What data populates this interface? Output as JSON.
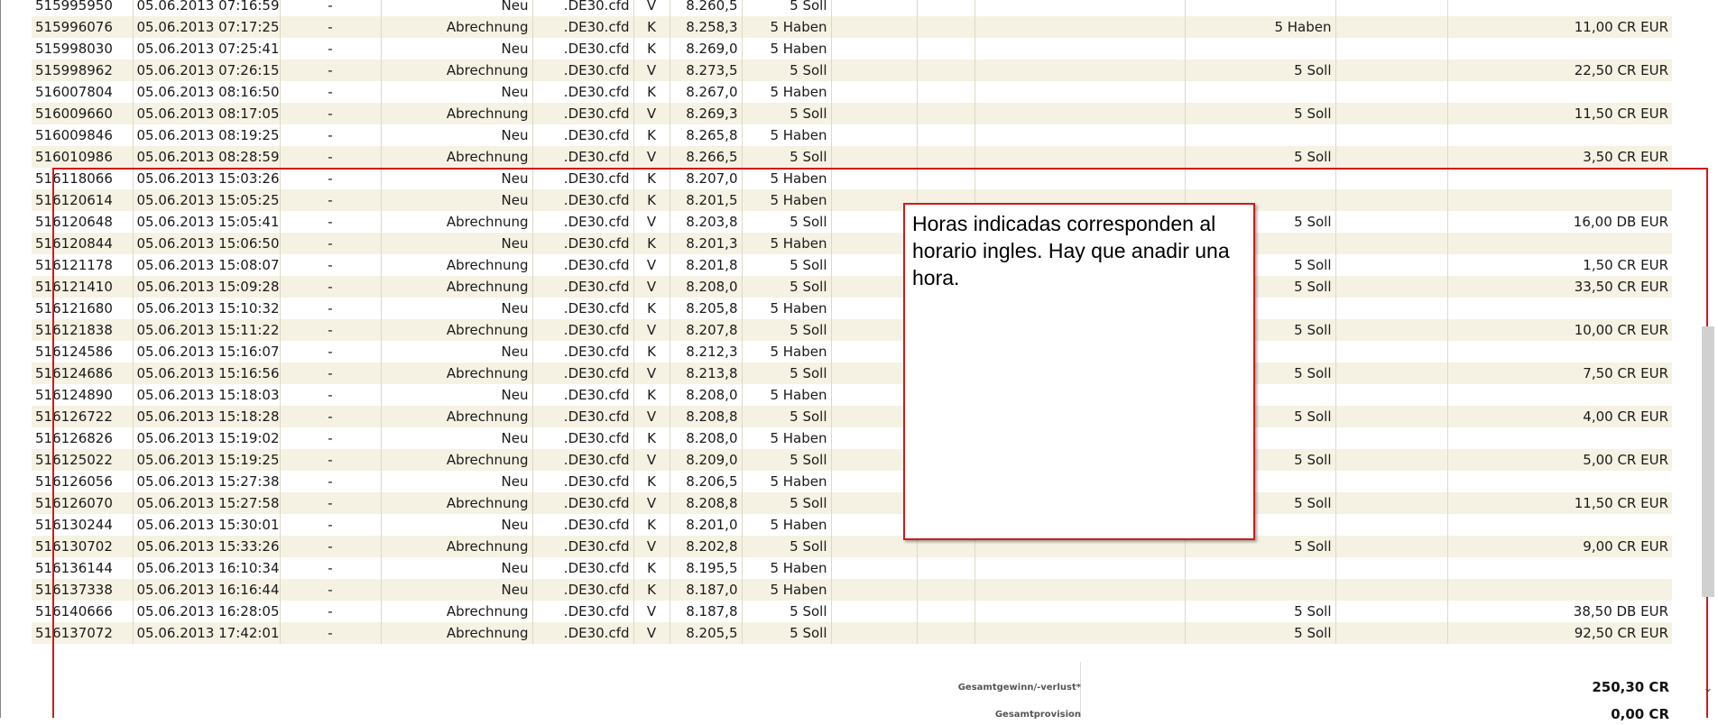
{
  "transactions": [
    {
      "id": "515995950",
      "datetime": "05.06.2013 07:16:59",
      "dash": "-",
      "type": "Neu",
      "instrument": ".DE30.cfd",
      "side": "V",
      "price": "8.260,5",
      "qty": "5 Soll",
      "status": "",
      "amount": ""
    },
    {
      "id": "515996076",
      "datetime": "05.06.2013 07:17:25",
      "dash": "-",
      "type": "Abrechnung",
      "instrument": ".DE30.cfd",
      "side": "K",
      "price": "8.258,3",
      "qty": "5 Haben",
      "status": "5 Haben",
      "amount": "11,00 CR EUR"
    },
    {
      "id": "515998030",
      "datetime": "05.06.2013 07:25:41",
      "dash": "-",
      "type": "Neu",
      "instrument": ".DE30.cfd",
      "side": "K",
      "price": "8.269,0",
      "qty": "5 Haben",
      "status": "",
      "amount": ""
    },
    {
      "id": "515998962",
      "datetime": "05.06.2013 07:26:15",
      "dash": "-",
      "type": "Abrechnung",
      "instrument": ".DE30.cfd",
      "side": "V",
      "price": "8.273,5",
      "qty": "5 Soll",
      "status": "5 Soll",
      "amount": "22,50 CR EUR"
    },
    {
      "id": "516007804",
      "datetime": "05.06.2013 08:16:50",
      "dash": "-",
      "type": "Neu",
      "instrument": ".DE30.cfd",
      "side": "K",
      "price": "8.267,0",
      "qty": "5 Haben",
      "status": "",
      "amount": ""
    },
    {
      "id": "516009660",
      "datetime": "05.06.2013 08:17:05",
      "dash": "-",
      "type": "Abrechnung",
      "instrument": ".DE30.cfd",
      "side": "V",
      "price": "8.269,3",
      "qty": "5 Soll",
      "status": "5 Soll",
      "amount": "11,50 CR EUR"
    },
    {
      "id": "516009846",
      "datetime": "05.06.2013 08:19:25",
      "dash": "-",
      "type": "Neu",
      "instrument": ".DE30.cfd",
      "side": "K",
      "price": "8.265,8",
      "qty": "5 Haben",
      "status": "",
      "amount": ""
    },
    {
      "id": "516010986",
      "datetime": "05.06.2013 08:28:59",
      "dash": "-",
      "type": "Abrechnung",
      "instrument": ".DE30.cfd",
      "side": "V",
      "price": "8.266,5",
      "qty": "5 Soll",
      "status": "5 Soll",
      "amount": "3,50 CR EUR"
    },
    {
      "id": "516118066",
      "datetime": "05.06.2013 15:03:26",
      "dash": "-",
      "type": "Neu",
      "instrument": ".DE30.cfd",
      "side": "K",
      "price": "8.207,0",
      "qty": "5 Haben",
      "status": "",
      "amount": ""
    },
    {
      "id": "516120614",
      "datetime": "05.06.2013 15:05:25",
      "dash": "-",
      "type": "Neu",
      "instrument": ".DE30.cfd",
      "side": "K",
      "price": "8.201,5",
      "qty": "5 Haben",
      "status": "",
      "amount": ""
    },
    {
      "id": "516120648",
      "datetime": "05.06.2013 15:05:41",
      "dash": "-",
      "type": "Abrechnung",
      "instrument": ".DE30.cfd",
      "side": "V",
      "price": "8.203,8",
      "qty": "5 Soll",
      "status": "5 Soll",
      "amount": "16,00 DB EUR"
    },
    {
      "id": "516120844",
      "datetime": "05.06.2013 15:06:50",
      "dash": "-",
      "type": "Neu",
      "instrument": ".DE30.cfd",
      "side": "K",
      "price": "8.201,3",
      "qty": "5 Haben",
      "status": "",
      "amount": ""
    },
    {
      "id": "516121178",
      "datetime": "05.06.2013 15:08:07",
      "dash": "-",
      "type": "Abrechnung",
      "instrument": ".DE30.cfd",
      "side": "V",
      "price": "8.201,8",
      "qty": "5 Soll",
      "status": "5 Soll",
      "amount": "1,50 CR EUR"
    },
    {
      "id": "516121410",
      "datetime": "05.06.2013 15:09:28",
      "dash": "-",
      "type": "Abrechnung",
      "instrument": ".DE30.cfd",
      "side": "V",
      "price": "8.208,0",
      "qty": "5 Soll",
      "status": "5 Soll",
      "amount": "33,50 CR EUR"
    },
    {
      "id": "516121680",
      "datetime": "05.06.2013 15:10:32",
      "dash": "-",
      "type": "Neu",
      "instrument": ".DE30.cfd",
      "side": "K",
      "price": "8.205,8",
      "qty": "5 Haben",
      "status": "",
      "amount": ""
    },
    {
      "id": "516121838",
      "datetime": "05.06.2013 15:11:22",
      "dash": "-",
      "type": "Abrechnung",
      "instrument": ".DE30.cfd",
      "side": "V",
      "price": "8.207,8",
      "qty": "5 Soll",
      "status": "5 Soll",
      "amount": "10,00 CR EUR"
    },
    {
      "id": "516124586",
      "datetime": "05.06.2013 15:16:07",
      "dash": "-",
      "type": "Neu",
      "instrument": ".DE30.cfd",
      "side": "K",
      "price": "8.212,3",
      "qty": "5 Haben",
      "status": "",
      "amount": ""
    },
    {
      "id": "516124686",
      "datetime": "05.06.2013 15:16:56",
      "dash": "-",
      "type": "Abrechnung",
      "instrument": ".DE30.cfd",
      "side": "V",
      "price": "8.213,8",
      "qty": "5 Soll",
      "status": "5 Soll",
      "amount": "7,50 CR EUR"
    },
    {
      "id": "516124890",
      "datetime": "05.06.2013 15:18:03",
      "dash": "-",
      "type": "Neu",
      "instrument": ".DE30.cfd",
      "side": "K",
      "price": "8.208,0",
      "qty": "5 Haben",
      "status": "",
      "amount": ""
    },
    {
      "id": "516126722",
      "datetime": "05.06.2013 15:18:28",
      "dash": "-",
      "type": "Abrechnung",
      "instrument": ".DE30.cfd",
      "side": "V",
      "price": "8.208,8",
      "qty": "5 Soll",
      "status": "5 Soll",
      "amount": "4,00 CR EUR"
    },
    {
      "id": "516126826",
      "datetime": "05.06.2013 15:19:02",
      "dash": "-",
      "type": "Neu",
      "instrument": ".DE30.cfd",
      "side": "K",
      "price": "8.208,0",
      "qty": "5 Haben",
      "status": "",
      "amount": ""
    },
    {
      "id": "516125022",
      "datetime": "05.06.2013 15:19:25",
      "dash": "-",
      "type": "Abrechnung",
      "instrument": ".DE30.cfd",
      "side": "V",
      "price": "8.209,0",
      "qty": "5 Soll",
      "status": "5 Soll",
      "amount": "5,00 CR EUR"
    },
    {
      "id": "516126056",
      "datetime": "05.06.2013 15:27:38",
      "dash": "-",
      "type": "Neu",
      "instrument": ".DE30.cfd",
      "side": "K",
      "price": "8.206,5",
      "qty": "5 Haben",
      "status": "",
      "amount": ""
    },
    {
      "id": "516126070",
      "datetime": "05.06.2013 15:27:58",
      "dash": "-",
      "type": "Abrechnung",
      "instrument": ".DE30.cfd",
      "side": "V",
      "price": "8.208,8",
      "qty": "5 Soll",
      "status": "5 Soll",
      "amount": "11,50 CR EUR"
    },
    {
      "id": "516130244",
      "datetime": "05.06.2013 15:30:01",
      "dash": "-",
      "type": "Neu",
      "instrument": ".DE30.cfd",
      "side": "K",
      "price": "8.201,0",
      "qty": "5 Haben",
      "status": "",
      "amount": ""
    },
    {
      "id": "516130702",
      "datetime": "05.06.2013 15:33:26",
      "dash": "-",
      "type": "Abrechnung",
      "instrument": ".DE30.cfd",
      "side": "V",
      "price": "8.202,8",
      "qty": "5 Soll",
      "status": "5 Soll",
      "amount": "9,00 CR EUR"
    },
    {
      "id": "516136144",
      "datetime": "05.06.2013 16:10:34",
      "dash": "-",
      "type": "Neu",
      "instrument": ".DE30.cfd",
      "side": "K",
      "price": "8.195,5",
      "qty": "5 Haben",
      "status": "",
      "amount": ""
    },
    {
      "id": "516137338",
      "datetime": "05.06.2013 16:16:44",
      "dash": "-",
      "type": "Neu",
      "instrument": ".DE30.cfd",
      "side": "K",
      "price": "8.187,0",
      "qty": "5 Haben",
      "status": "",
      "amount": ""
    },
    {
      "id": "516140666",
      "datetime": "05.06.2013 16:28:05",
      "dash": "-",
      "type": "Abrechnung",
      "instrument": ".DE30.cfd",
      "side": "V",
      "price": "8.187,8",
      "qty": "5 Soll",
      "status": "5 Soll",
      "amount": "38,50 DB EUR"
    },
    {
      "id": "516137072",
      "datetime": "05.06.2013 17:42:01",
      "dash": "-",
      "type": "Abrechnung",
      "instrument": ".DE30.cfd",
      "side": "V",
      "price": "8.205,5",
      "qty": "5 Soll",
      "status": "5 Soll",
      "amount": "92,50 CR EUR"
    }
  ],
  "summary": {
    "gesamtgewinn_label": "Gesamtgewinn/-verlust*",
    "gesamtgewinn_value": "250,30 CR",
    "gesamtprovision_label": "Gesamtprovision",
    "gesamtprovision_value": "0,00 CR"
  },
  "annotation": {
    "text": "Horas indicadas corresponden al horario ingles. Hay que anadir una hora.",
    "border_color": "#d11a1a"
  },
  "colors": {
    "row_alt": "#f5f2e3",
    "highlight": "#d11a1a"
  }
}
